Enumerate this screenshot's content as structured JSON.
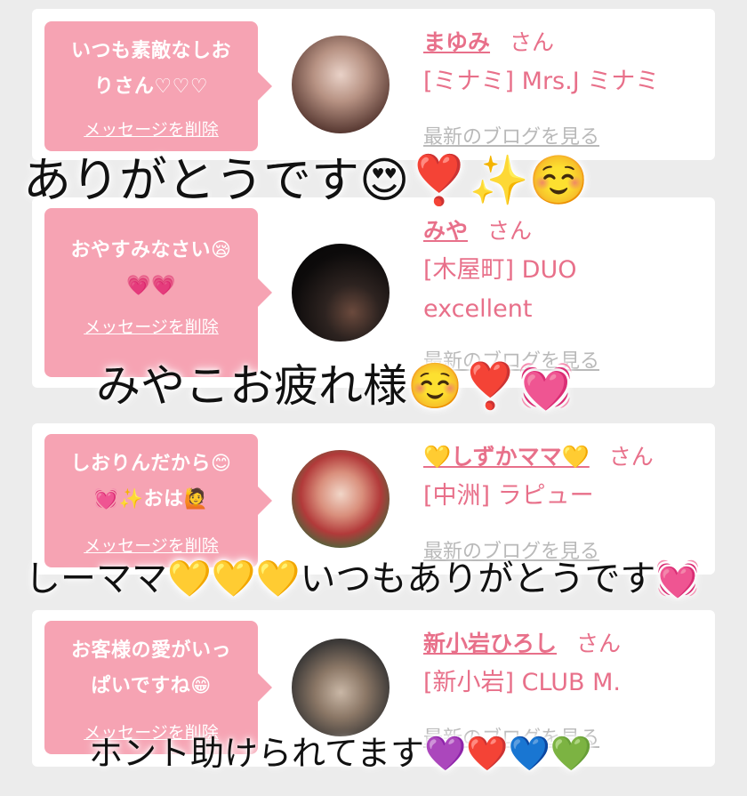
{
  "cards": [
    {
      "message": "いつも素敵なしお\nりさん♡♡♡",
      "delete_label": "メッセージを削除",
      "name": "まゆみ",
      "honorific": "さん",
      "shop": "[ミナミ] Mrs.J ミナミ",
      "blog_label": "最新のブログを見る"
    },
    {
      "message": "おやすみなさい😪\n💗💗",
      "delete_label": "メッセージを削除",
      "name": "みや",
      "honorific": "さん",
      "shop": "[木屋町] DUO\nexcellent",
      "blog_label": "最新のブログを見る"
    },
    {
      "message": "しおりんだから😊\n💓✨おは🙋",
      "delete_label": "メッセージを削除",
      "name": "💛しずかママ💛",
      "honorific": "さん",
      "shop": "[中洲] ラピュー",
      "blog_label": "最新のブログを見る"
    },
    {
      "message": "お客様の愛がいっ\nぱいですね😁",
      "delete_label": "メッセージを削除",
      "name": "新小岩ひろし",
      "honorific": "さん",
      "shop": "[新小岩] CLUB M.",
      "blog_label": "最新のブログを見る"
    }
  ],
  "overlays": [
    "ありがとうです😍❣️✨☺️",
    "みやこお疲れ様☺️❣️💓",
    "しーママ💛💛💛いつもありがとうです💓",
    "ホント助けられてます💜❤️💙💚"
  ],
  "colors": {
    "background": "#ececec",
    "card": "#ffffff",
    "bubble": "#f6a3b3",
    "accent_pink": "#e8708a",
    "blog_grey": "#b9b9b9"
  }
}
